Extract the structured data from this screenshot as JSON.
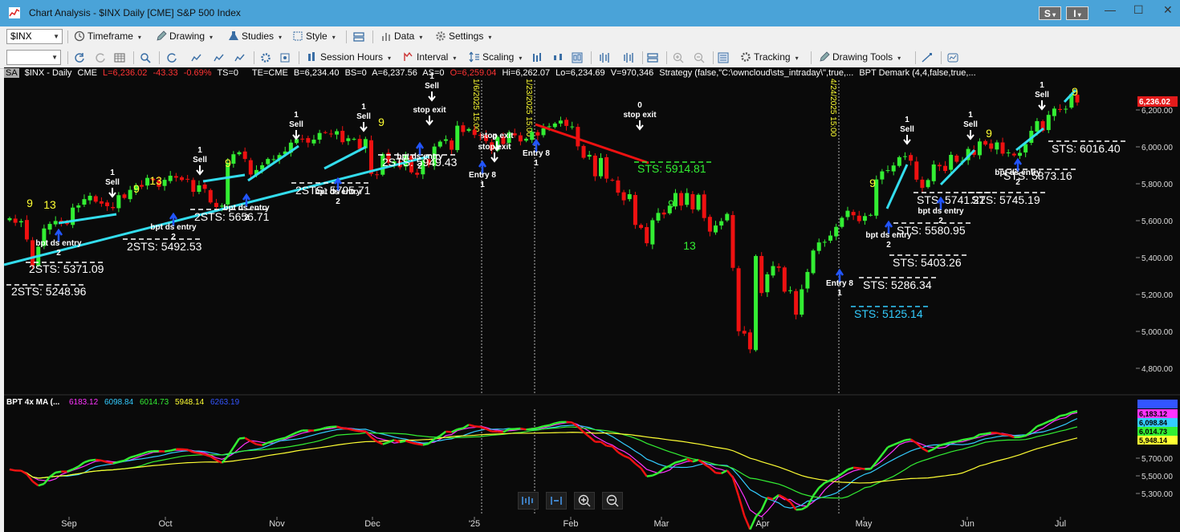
{
  "window": {
    "title": "Chart Analysis - $INX Daily [CME] S&P 500 Index",
    "btn_s": "S",
    "btn_i": "I",
    "minimize": "—",
    "restore": "☐",
    "close": "✕"
  },
  "toolbar1": {
    "symbol": "$INX",
    "timeframe": "Timeframe",
    "drawing": "Drawing",
    "studies": "Studies",
    "style": "Style",
    "data": "Data",
    "settings": "Settings"
  },
  "toolbar2": {
    "session_hours": "Session Hours",
    "interval": "Interval",
    "scaling": "Scaling",
    "tracking": "Tracking",
    "drawing_tools": "Drawing Tools"
  },
  "info": {
    "sa": "SA",
    "symbol": "$INX - Daily",
    "exchange": "CME",
    "last": "L=6,236.02",
    "chg": "-43.33",
    "pct": "-0.69%",
    "ts": "TS=0",
    "te": "TE=CME",
    "bid": "B=6,234.40",
    "bs": "BS=0",
    "ask": "A=6,237.56",
    "as": "AS=0",
    "open": "O=6,259.04",
    "high": "Hi=6,262.07",
    "low": "Lo=6,234.69",
    "vol": "V=970,346",
    "strategy": "Strategy (false,\"C:\\owncloud\\sts_intraday\\\",true,...",
    "demark": "BPT Demark (4,4,false,true,..."
  },
  "price_axis": {
    "ticks": [
      "6,200.00",
      "6,000.00",
      "5,800.00",
      "5,600.00",
      "5,400.00",
      "5,200.00",
      "5,000.00",
      "4,800.00"
    ],
    "last_tag": "6,236.02",
    "last_color": "#e31b1b"
  },
  "sub_axis": {
    "ticks": [
      "5,700.00",
      "5,500.00",
      "5,300.00"
    ],
    "tags": [
      {
        "label": "6,183.12",
        "color": "#ff33ff"
      },
      {
        "label": "6,098.84",
        "color": "#33ccff"
      },
      {
        "label": "6,014.73",
        "color": "#33ee33"
      },
      {
        "label": "5,948.14",
        "color": "#ffff33"
      }
    ]
  },
  "months": [
    "Sep",
    "Oct",
    "Nov",
    "Dec",
    "'25",
    "Feb",
    "Mar",
    "Apr",
    "May",
    "Jun",
    "Jul"
  ],
  "vlines": [
    {
      "date": "1/6/2025 15:00"
    },
    {
      "date": "1/23/2025 15:00"
    },
    {
      "date": "4/24/2025 15:00"
    }
  ],
  "annotations": {
    "sts_labels": [
      {
        "text": "2STS: 5248.96",
        "color": "#ffffff"
      },
      {
        "text": "2STS: 5371.09",
        "color": "#ffffff"
      },
      {
        "text": "2STS: 5492.53",
        "color": "#ffffff"
      },
      {
        "text": "2STS: 5656.71",
        "color": "#ffffff"
      },
      {
        "text": "2STS: 5705.71",
        "color": "#ffffff"
      },
      {
        "text": "2STS: 5949.43",
        "color": "#ffffff"
      },
      {
        "text": "STS: 5914.81",
        "color": "#33ee33"
      },
      {
        "text": "STS: 5125.14",
        "color": "#33ccff"
      },
      {
        "text": "STS: 5286.34",
        "color": "#ffffff"
      },
      {
        "text": "STS: 5403.26",
        "color": "#ffffff"
      },
      {
        "text": "STS: 5580.95",
        "color": "#ffffff"
      },
      {
        "text": "STS: 5741.22",
        "color": "#ffffff"
      },
      {
        "text": "STS: 5745.19",
        "color": "#ffffff"
      },
      {
        "text": "STS: 5873.16",
        "color": "#ffffff"
      },
      {
        "text": "STS: 6016.40",
        "color": "#ffffff"
      }
    ],
    "signals": [
      {
        "lines": [
          "1",
          "Sell"
        ]
      },
      {
        "lines": [
          "1",
          "Sell"
        ]
      },
      {
        "lines": [
          "1",
          "Sell"
        ]
      },
      {
        "lines": [
          "1",
          "Sell"
        ]
      },
      {
        "lines": [
          "1",
          "Sell"
        ]
      },
      {
        "lines": [
          "1",
          "Sell"
        ]
      },
      {
        "lines": [
          "1",
          "Sell"
        ]
      },
      {
        "lines": [
          "1",
          "Sell"
        ]
      },
      {
        "lines": [
          "stop exit"
        ]
      },
      {
        "lines": [
          "stop exit"
        ]
      },
      {
        "lines": [
          "0",
          "stop exit"
        ]
      },
      {
        "lines": [
          "0",
          "stop exit"
        ]
      }
    ],
    "entries": [
      {
        "text": "bpt ds entry",
        "sub": "2"
      },
      {
        "text": "bpt ds entry",
        "sub": "2"
      },
      {
        "text": "bpt ds entry",
        "sub": "2"
      },
      {
        "text": "bpt ds entry",
        "sub": "2"
      },
      {
        "text": "bpt ds entry",
        "sub": "2"
      },
      {
        "text": "bpt ds entry",
        "sub": "2"
      },
      {
        "text": "bpt ds entry",
        "sub": "2"
      },
      {
        "text": "bpt ds entry",
        "sub": "2"
      },
      {
        "text": "Entry 8",
        "sub": "1"
      },
      {
        "text": "Entry 8",
        "sub": "1"
      },
      {
        "text": "Entry 8",
        "sub": "1"
      }
    ],
    "counts": [
      {
        "text": "9",
        "color": "#ffff33"
      },
      {
        "text": "13",
        "color": "#ffff33"
      },
      {
        "text": "9",
        "color": "#ffff33"
      },
      {
        "text": "13",
        "color": "#ffff33"
      },
      {
        "text": "9",
        "color": "#ffff33"
      },
      {
        "text": "9",
        "color": "#ffff33"
      },
      {
        "text": "9",
        "color": "#33ee33"
      },
      {
        "text": "13",
        "color": "#33ee33"
      },
      {
        "text": "9",
        "color": "#ffff33"
      },
      {
        "text": "9",
        "color": "#ffff33"
      },
      {
        "text": "9",
        "color": "#ffff33"
      }
    ]
  },
  "sub_legend": {
    "name": "BPT 4x MA (...",
    "v1": "6183.12",
    "v2": "6098.84",
    "v3": "6014.73",
    "v4": "5948.14",
    "v5": "6263.19"
  },
  "colors": {
    "up": "#33ee33",
    "down": "#ee1111",
    "trend_cyan": "#33ddee",
    "trend_red": "#ee1111",
    "magenta": "#ff33ff",
    "cyan": "#33ccff",
    "yellow": "#ffff33",
    "blue": "#3355ff"
  },
  "chart_data": {
    "type": "candlestick",
    "y_range": [
      4750,
      6330
    ],
    "sub_range": [
      5200,
      6300
    ],
    "closes": [
      5648,
      5625,
      5633,
      5540,
      5408,
      5503,
      5596,
      5619,
      5634,
      5626,
      5618,
      5702,
      5713,
      5745,
      5762,
      5732,
      5722,
      5709,
      5699,
      5765,
      5751,
      5792,
      5815,
      5808,
      5853,
      5841,
      5808,
      5843,
      5864,
      5854,
      5842,
      5846,
      5782,
      5815,
      5797,
      5728,
      5705,
      5712,
      5929,
      5973,
      5983,
      5949,
      5870,
      5893,
      5917,
      5949,
      5948,
      5969,
      5987,
      6032,
      6050,
      6049,
      6032,
      6047,
      6081,
      6084,
      6075,
      6090,
      6034,
      6054,
      6051,
      6000,
      6050,
      5873,
      5867,
      5974,
      5930,
      5937,
      5907,
      5970,
      5881,
      5869,
      5942,
      5918,
      6012,
      6037,
      6049,
      5996,
      6118,
      6086,
      6101,
      6071,
      6067,
      6040,
      5994,
      6061,
      6025,
      6083,
      6069,
      6038,
      6052,
      6087,
      6068,
      6105,
      6115,
      6129,
      6144,
      6117,
      6114,
      6013,
      5955,
      5970,
      5861,
      5954,
      5849,
      5842,
      5778,
      5739,
      5770,
      5614,
      5599,
      5521,
      5638,
      5675,
      5667,
      5712,
      5776,
      5712,
      5776,
      5693,
      5767,
      5649,
      5580,
      5611,
      5633,
      5670,
      5396,
      5074,
      5062,
      4982,
      5456,
      5268,
      5363,
      5405,
      5396,
      5275,
      5282,
      5158,
      5287,
      5375,
      5484,
      5525,
      5528,
      5560,
      5604,
      5650,
      5686,
      5663,
      5633,
      5659,
      5665,
      5845,
      5886,
      5892,
      5916,
      5958,
      5963,
      5940,
      5844,
      5802,
      5842,
      5921,
      5912,
      5888,
      5970,
      5935,
      5939,
      6000,
      5970,
      6038,
      6022,
      6001,
      6033,
      5976,
      5982,
      5967,
      5980,
      6025,
      6092,
      6141,
      6092,
      6173,
      6205,
      6198,
      6204,
      6279,
      6236
    ]
  }
}
